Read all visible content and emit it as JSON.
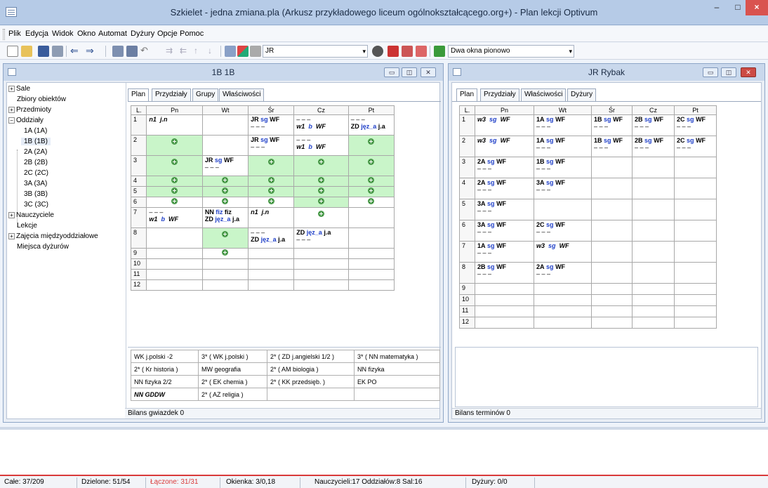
{
  "window": {
    "title": "Szkielet - jedna zmiana.pla (Arkusz przykładowego liceum ogólnokształcącego.org+) - Plan lekcji Optivum",
    "min": "–",
    "max": "□",
    "close": "×"
  },
  "menu": [
    "Plik",
    "Edycja",
    "Widok",
    "Okno",
    "Automat",
    "Dyżury",
    "Opcje",
    "Pomoc"
  ],
  "toolbar": {
    "teacher_combo": "JR",
    "view_combo": "Dwa okna pionowo"
  },
  "left_window": {
    "title": "1B 1B",
    "tree": {
      "items": [
        {
          "label": "Sale",
          "expander": "+"
        },
        {
          "label": "Zbiory obiektów",
          "expander": ""
        },
        {
          "label": "Przedmioty",
          "expander": "+"
        },
        {
          "label": "Oddziały",
          "expander": "−"
        },
        {
          "label": "1A (1A)",
          "expander": ""
        },
        {
          "label": "1B (1B)",
          "expander": ""
        },
        {
          "label": "2A (2A)",
          "expander": ""
        },
        {
          "label": "2B (2B)",
          "expander": ""
        },
        {
          "label": "2C (2C)",
          "expander": ""
        },
        {
          "label": "3A (3A)",
          "expander": ""
        },
        {
          "label": "3B (3B)",
          "expander": ""
        },
        {
          "label": "3C (3C)",
          "expander": ""
        },
        {
          "label": "Nauczyciele",
          "expander": "+"
        },
        {
          "label": "Lekcje",
          "expander": ""
        },
        {
          "label": "Zajęcia międzyoddziałowe",
          "expander": "+"
        },
        {
          "label": "Miejsca dyżurów",
          "expander": ""
        }
      ]
    },
    "tabs": [
      "Plan",
      "Przydziały",
      "Grupy",
      "Właściwości"
    ],
    "grid": {
      "headers": [
        "L.",
        "Pn",
        "Wt",
        "Śr",
        "Cz",
        "Pt"
      ],
      "rows": [
        "1",
        "2",
        "3",
        "4",
        "5",
        "6",
        "7",
        "8",
        "9",
        "10",
        "11",
        "12"
      ],
      "cells": {
        "r1_pn_a": "n1",
        "r1_pn_b": "j.n",
        "r1_sr_l1": "JR",
        "r1_sr_l2": "sg",
        "r1_sr_l3": "WF",
        "r1_sr_l4": "– – –",
        "r1_cz_l1": "– – –",
        "r1_cz_l2": "w1",
        "r1_cz_l3": "b",
        "r1_cz_l4": "WF",
        "r1_pt_l1": "– – –",
        "r1_pt_l2": "ZD",
        "r1_pt_l3": "jęz_a",
        "r1_pt_l4": "j.a",
        "r2_sr_l1": "JR",
        "r2_sr_l2": "sg",
        "r2_sr_l3": "WF",
        "r2_sr_l4": "– – –",
        "r2_cz_l1": "– – –",
        "r2_cz_l2": "w1",
        "r2_cz_l3": "b",
        "r2_cz_l4": "WF",
        "r3_wt_l1": "JR",
        "r3_wt_l2": "sg",
        "r3_wt_l3": "WF",
        "r3_wt_l4": "– – –",
        "r7_pn_l1": "– – –",
        "r7_pn_l2": "w1",
        "r7_pn_l3": "b",
        "r7_pn_l4": "WF",
        "r7_wt_l1": "NN",
        "r7_wt_l2": "fiz",
        "r7_wt_l3": "fiz",
        "r7_wt_l4": "ZD",
        "r7_wt_l5": "jęz_a",
        "r7_wt_l6": "j.a",
        "r7_sr_a": "n1",
        "r7_sr_b": "j.n",
        "r8_sr_l1": "– – –",
        "r8_sr_l2": "ZD",
        "r8_sr_l3": "jęz_a",
        "r8_sr_l4": "j.a",
        "r8_cz_l1": "ZD",
        "r8_cz_l2": "jęz_a",
        "r8_cz_l3": "j.a",
        "r8_cz_l4": "– – –"
      }
    },
    "bottom_rows": [
      [
        "WK j.polski -2",
        "3* ( WK j.polski )",
        "2* ( ZD j.angielski 1/2 )",
        "3* ( NN matematyka )"
      ],
      [
        "2* ( Kr historia )",
        "MW geografia",
        "2* ( AM biologia )",
        "NN fizyka"
      ],
      [
        "NN fizyka 2/2",
        "2* ( EK chemia )",
        "2* ( KK przedsięb. )",
        "EK PO"
      ],
      [
        "NN GDDW",
        "2* ( AZ religia )",
        "",
        ""
      ]
    ],
    "status": "Bilans gwiazdek 0"
  },
  "right_window": {
    "title": "JR Rybak",
    "tabs": [
      "Plan",
      "Przydziały",
      "Właściwości",
      "Dyżury"
    ],
    "grid": {
      "headers": [
        "L.",
        "Pn",
        "Wt",
        "Śr",
        "Cz",
        "Pt"
      ],
      "rows": [
        "1",
        "2",
        "3",
        "4",
        "5",
        "6",
        "7",
        "8",
        "9",
        "10",
        "11",
        "12"
      ],
      "cells": {
        "r1_pn": [
          "w3",
          "sg",
          "WF"
        ],
        "r1_wt": [
          "1A",
          "sg",
          "WF"
        ],
        "r1_sr": [
          "1B",
          "sg",
          "WF"
        ],
        "r1_cz": [
          "2B",
          "sg",
          "WF"
        ],
        "r1_pt": [
          "2C",
          "sg",
          "WF"
        ],
        "r2_pn": [
          "w3",
          "sg",
          "WF"
        ],
        "r2_wt": [
          "1A",
          "sg",
          "WF"
        ],
        "r2_sr": [
          "1B",
          "sg",
          "WF"
        ],
        "r2_cz": [
          "2B",
          "sg",
          "WF"
        ],
        "r2_pt": [
          "2C",
          "sg",
          "WF"
        ],
        "r3_pn": [
          "2A",
          "sg",
          "WF"
        ],
        "r3_wt": [
          "1B",
          "sg",
          "WF"
        ],
        "r4_pn": [
          "2A",
          "sg",
          "WF"
        ],
        "r4_wt": [
          "3A",
          "sg",
          "WF"
        ],
        "r5_pn": [
          "3A",
          "sg",
          "WF"
        ],
        "r6_pn": [
          "3A",
          "sg",
          "WF"
        ],
        "r6_wt": [
          "2C",
          "sg",
          "WF"
        ],
        "r7_pn": [
          "1A",
          "sg",
          "WF"
        ],
        "r7_wt": [
          "w3",
          "sg",
          "WF"
        ],
        "r8_pn": [
          "2B",
          "sg",
          "WF"
        ],
        "r8_wt": [
          "2A",
          "sg",
          "WF"
        ],
        "dash": "– – –"
      }
    },
    "status": "Bilans terminów 0"
  },
  "statusbar": {
    "cale": "Całe: 37/209",
    "dzielone": "Dzielone: 51/54",
    "laczone": "Łączone: 31/31",
    "okienka": "Okienka: 3/0,18",
    "counts": "Nauczycieli:17 Oddziałów:8 Sal:16",
    "dyzury": "Dyżury: 0/0"
  },
  "colors": {
    "green_cell": "#c9f5c9",
    "blue_text": "#2040c8",
    "status_red": "#d93a3a"
  }
}
